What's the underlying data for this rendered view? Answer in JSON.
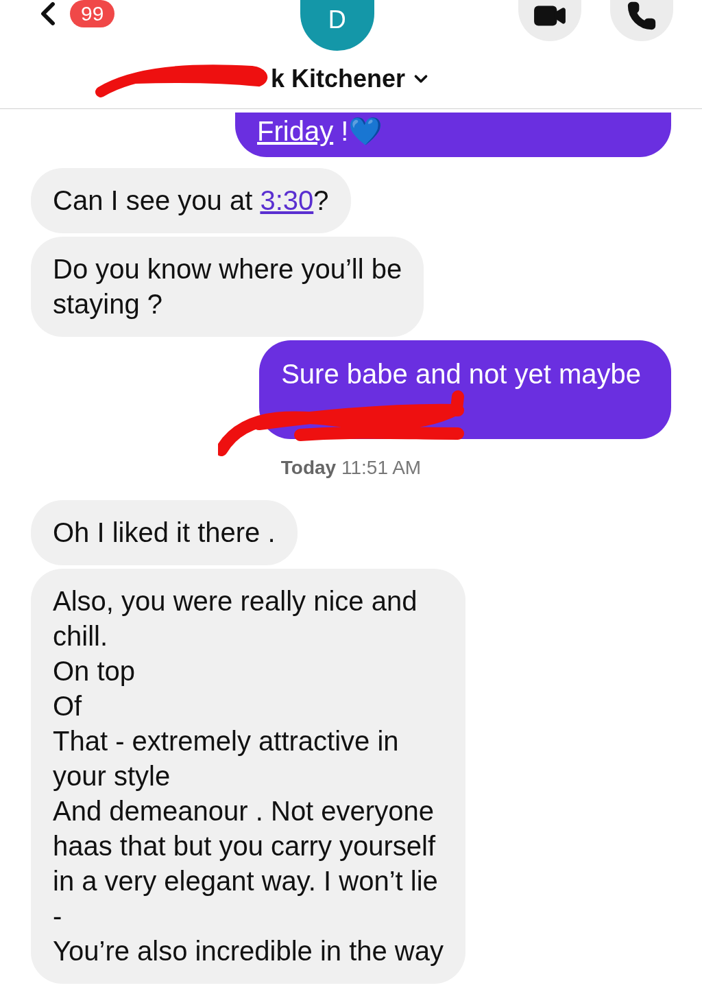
{
  "header": {
    "unread_badge": "99",
    "avatar_letter": "D",
    "contact_name": "k Kitchener"
  },
  "messages": [
    {
      "kind": "sent",
      "cut_top": true,
      "scribble": false,
      "parts": [
        {
          "kind": "link",
          "text": "Friday"
        },
        {
          "kind": "text",
          "text": " !💙"
        }
      ]
    },
    {
      "kind": "received",
      "cut_top": false,
      "scribble": false,
      "parts": [
        {
          "kind": "text",
          "text": "Can I see you at "
        },
        {
          "kind": "link",
          "text": "3:30"
        },
        {
          "kind": "text",
          "text": "?"
        }
      ]
    },
    {
      "kind": "received",
      "cut_top": false,
      "scribble": false,
      "parts": [
        {
          "kind": "text",
          "text": "Do you know where you’ll be\nstaying ?"
        }
      ]
    },
    {
      "kind": "sent",
      "cut_top": false,
      "scribble": true,
      "parts": [
        {
          "kind": "text",
          "text": "Sure babe and not yet maybe\n "
        }
      ]
    },
    {
      "kind": "timestamp",
      "text": "**Today** 11:51 AM"
    },
    {
      "kind": "received",
      "cut_top": false,
      "scribble": false,
      "parts": [
        {
          "kind": "text",
          "text": "Oh I liked it there ."
        }
      ]
    },
    {
      "kind": "received",
      "cut_top": false,
      "scribble": false,
      "parts": [
        {
          "kind": "text",
          "text": "Also, you were really nice and\nchill.\nOn top\nOf\nThat - extremely attractive in\nyour style\nAnd demeanour . Not everyone\nhaas that but you carry yourself\nin a very elegant way. I won’t lie\n-\nYou’re also incredible in the way"
        }
      ]
    }
  ]
}
